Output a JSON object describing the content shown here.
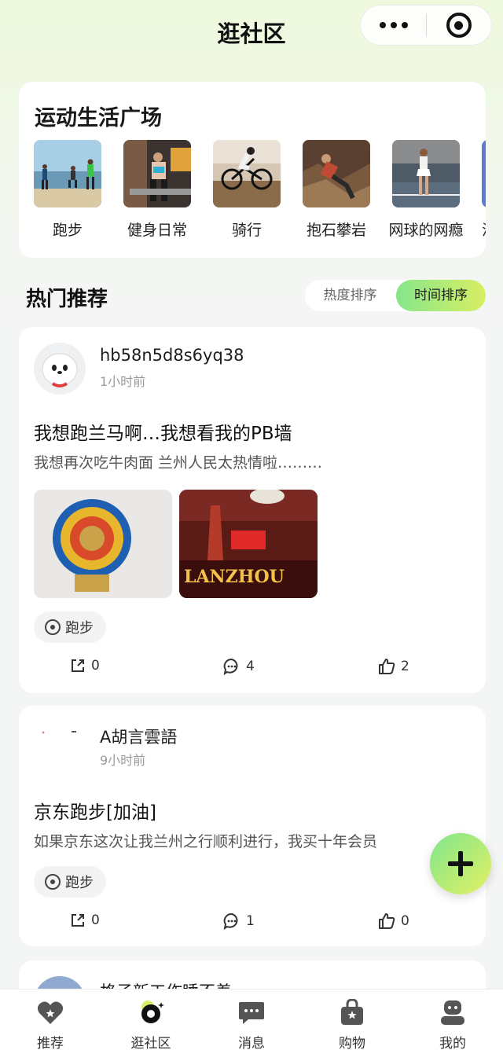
{
  "header": {
    "title": "逛社区"
  },
  "square": {
    "title": "运动生活广场",
    "items": [
      {
        "label": "跑步"
      },
      {
        "label": "健身日常"
      },
      {
        "label": "骑行"
      },
      {
        "label": "抱石攀岩"
      },
      {
        "label": "网球的网瘾"
      },
      {
        "label": "滑"
      }
    ]
  },
  "hot": {
    "title": "热门推荐",
    "sort_heat": "热度排序",
    "sort_time": "时间排序"
  },
  "posts": [
    {
      "username": "hb58n5d8s6yq38",
      "time": "1小时前",
      "title": "我想跑兰马啊…我想看我的PB墙",
      "desc": "我想再次吃牛肉面 兰州人民太热情啦………",
      "tag": "跑步",
      "share": "0",
      "comments": "4",
      "likes": "2",
      "image2_text": "LANZHOU"
    },
    {
      "username": "A胡言雲語",
      "time": "9小时前",
      "title": "京东跑步[加油]",
      "desc": "如果京东这次让我兰州之行顺利进行，我买十年会员",
      "tag": "跑步",
      "share": "0",
      "comments": "1",
      "likes": "0"
    },
    {
      "username": "格子新工作睡不着"
    }
  ],
  "tabbar": [
    {
      "label": "推荐"
    },
    {
      "label": "逛社区"
    },
    {
      "label": "消息"
    },
    {
      "label": "购物"
    },
    {
      "label": "我的"
    }
  ],
  "colors": {
    "accent_start": "#86e68a",
    "accent_end": "#d8ef63"
  }
}
